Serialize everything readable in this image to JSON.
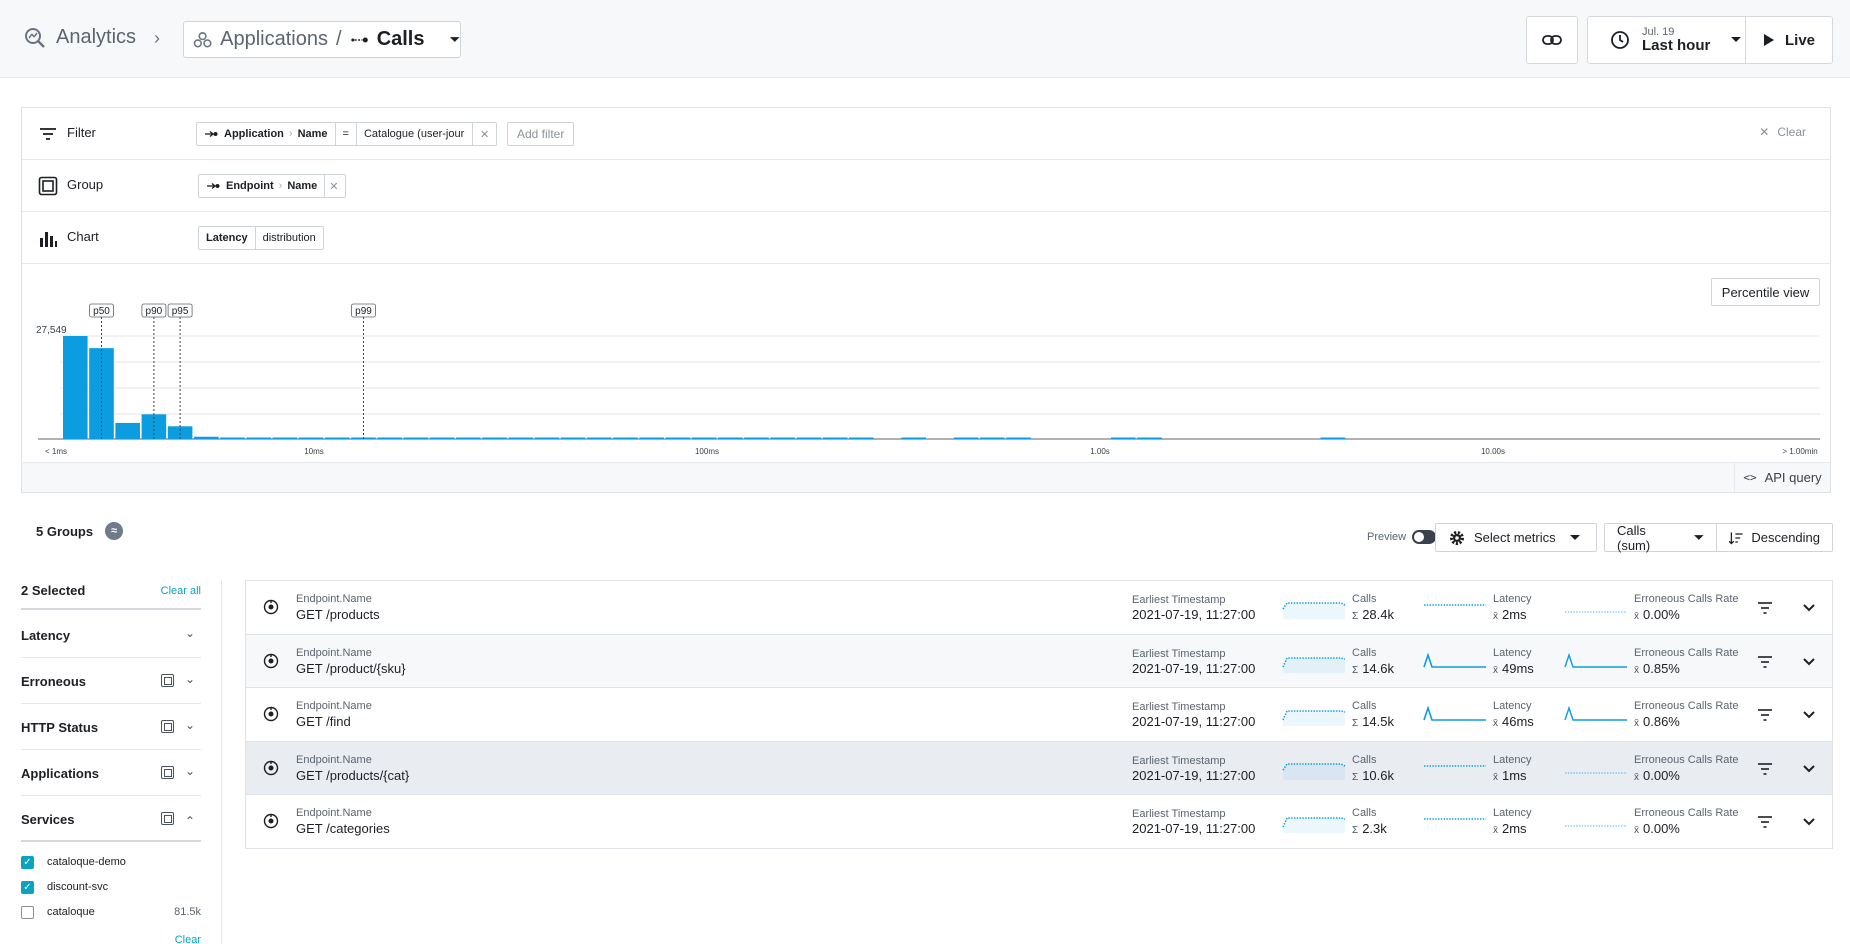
{
  "header": {
    "root": "Analytics",
    "app": "Applications",
    "slash": "/",
    "current": "Calls",
    "time_date": "Jul. 19",
    "time_range": "Last hour",
    "live": "Live"
  },
  "config": {
    "filter": {
      "label": "Filter",
      "chip_entity": "Application",
      "chip_field": "Name",
      "chip_op": "=",
      "chip_value": "Catalogue (user-jour",
      "add": "Add filter",
      "clear": "Clear"
    },
    "group": {
      "label": "Group",
      "chip_entity": "Endpoint",
      "chip_field": "Name"
    },
    "chart": {
      "label": "Chart",
      "metric": "Latency",
      "mode": "distribution"
    },
    "percentile_btn": "Percentile view",
    "api_query": "API query"
  },
  "chart_data": {
    "type": "bar",
    "title": "",
    "ymax_label": "27,549",
    "ymax": 27549,
    "x_ticks": [
      "< 1ms",
      "10ms",
      "100ms",
      "1.00s",
      "10.00s",
      "> 1.00min"
    ],
    "bar_values": [
      27549,
      24300,
      4300,
      6600,
      3400,
      600,
      300,
      250,
      200,
      200,
      200,
      200,
      200,
      200,
      200,
      200,
      200,
      200,
      200,
      200,
      200,
      200,
      200,
      200,
      200,
      200,
      200,
      150,
      150,
      150,
      150,
      0,
      150,
      0,
      150,
      150,
      150,
      0,
      0,
      0,
      150,
      150,
      0,
      0,
      0,
      0,
      0,
      0,
      150,
      0,
      0,
      0,
      0,
      0,
      0,
      0,
      0,
      0,
      0,
      0,
      0,
      0,
      0,
      0,
      0,
      0
    ],
    "percentiles": [
      {
        "label": "p50",
        "bucket": 1
      },
      {
        "label": "p90",
        "bucket": 3
      },
      {
        "label": "p95",
        "bucket": 4
      },
      {
        "label": "p99",
        "bucket": 11
      }
    ]
  },
  "groups": {
    "title": "5 Groups",
    "preview": "Preview",
    "select_metrics": "Select metrics",
    "sort_metric": "Calls (sum)",
    "sort_order": "Descending"
  },
  "sidebar": {
    "selected": "2 Selected",
    "clear_all": "Clear all",
    "facets": [
      "Latency",
      "Erroneous",
      "HTTP Status",
      "Applications",
      "Services"
    ],
    "services": [
      {
        "name": "cataloque-demo",
        "checked": true,
        "count": ""
      },
      {
        "name": "discount-svc",
        "checked": true,
        "count": ""
      },
      {
        "name": "cataloque",
        "checked": false,
        "count": "81.5k"
      }
    ],
    "clear": "Clear"
  },
  "rows": [
    {
      "key": "Endpoint.Name",
      "value": "GET /products",
      "ts_label": "Earliest Timestamp",
      "ts": "2021-07-19, 11:27:00",
      "calls_label": "Calls",
      "calls": "28.4k",
      "lat_label": "Latency",
      "lat": "2ms",
      "err_label": "Erroneous Calls Rate",
      "err": "0.00%"
    },
    {
      "key": "Endpoint.Name",
      "value": "GET /product/{sku}",
      "ts_label": "Earliest Timestamp",
      "ts": "2021-07-19, 11:27:00",
      "calls_label": "Calls",
      "calls": "14.6k",
      "lat_label": "Latency",
      "lat": "49ms",
      "err_label": "Erroneous Calls Rate",
      "err": "0.85%"
    },
    {
      "key": "Endpoint.Name",
      "value": "GET /find",
      "ts_label": "Earliest Timestamp",
      "ts": "2021-07-19, 11:27:00",
      "calls_label": "Calls",
      "calls": "14.5k",
      "lat_label": "Latency",
      "lat": "46ms",
      "err_label": "Erroneous Calls Rate",
      "err": "0.86%"
    },
    {
      "key": "Endpoint.Name",
      "value": "GET /products/{cat}",
      "ts_label": "Earliest Timestamp",
      "ts": "2021-07-19, 11:27:00",
      "calls_label": "Calls",
      "calls": "10.6k",
      "lat_label": "Latency",
      "lat": "1ms",
      "err_label": "Erroneous Calls Rate",
      "err": "0.00%"
    },
    {
      "key": "Endpoint.Name",
      "value": "GET /categories",
      "ts_label": "Earliest Timestamp",
      "ts": "2021-07-19, 11:27:00",
      "calls_label": "Calls",
      "calls": "2.3k",
      "lat_label": "Latency",
      "lat": "2ms",
      "err_label": "Erroneous Calls Rate",
      "err": "0.00%"
    }
  ],
  "symbols": {
    "sum": "Σ",
    "mean": "x̄"
  },
  "colors": {
    "accent": "#0aa3c2",
    "bar": "#0b9de0"
  }
}
